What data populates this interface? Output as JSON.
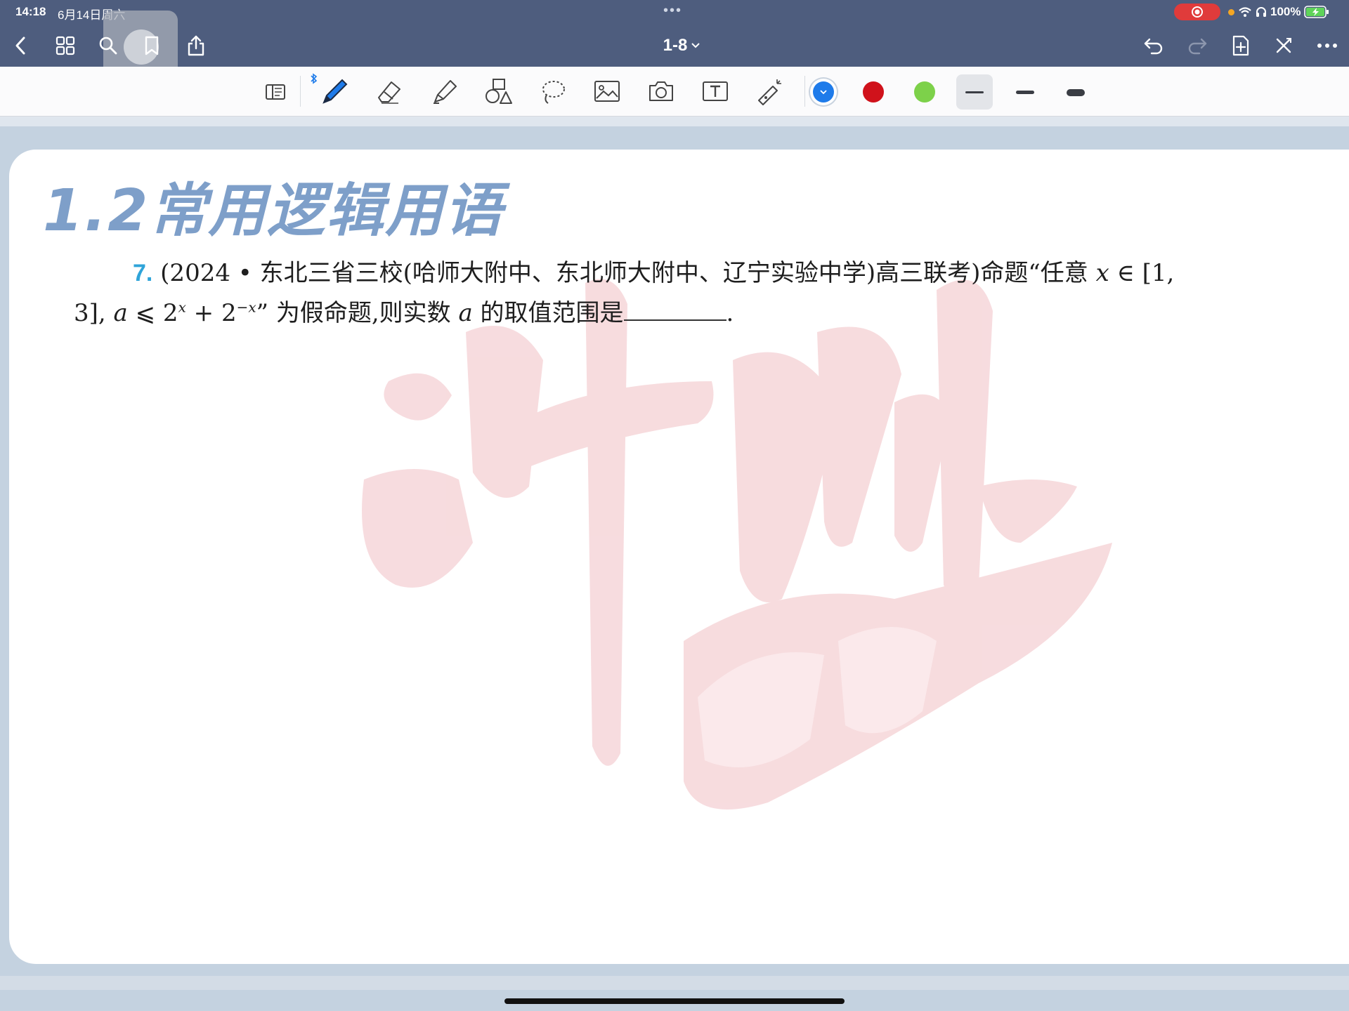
{
  "status_bar": {
    "time": "14:18",
    "date": "6月14日周六",
    "center_dots": "•••",
    "battery": "100%"
  },
  "nav": {
    "page_title": "1-8",
    "icons": [
      "back-icon",
      "grid-icon",
      "search-icon",
      "bookmark-icon",
      "share-icon",
      "undo-icon",
      "redo-icon",
      "add-page-icon",
      "close-icon",
      "more-icon"
    ]
  },
  "toolbar": {
    "tools": [
      "document-icon",
      "pen-icon",
      "eraser-icon",
      "highlighter-icon",
      "shapes-icon",
      "lasso-icon",
      "image-icon",
      "camera-icon",
      "text-icon",
      "laser-pointer-icon"
    ],
    "colors": {
      "selected_blue": "#1e7bea",
      "red": "#d0121b",
      "green": "#7dd14a"
    },
    "widths": [
      "thin",
      "medium",
      "thick"
    ]
  },
  "document": {
    "heading": "1.2常用逻辑用语",
    "problem": {
      "number": "7.",
      "line1_source": "(2024 • 东北三省三校(哈师大附中、东北师大附中、辽宁实验中学)高三联考)命题“任意",
      "line1_var": "x",
      "line1_tail": "∈ [1,",
      "line2_start": "3],",
      "line2_var_a": "a",
      "line2_leq": "⩽ 2",
      "line2_sup1": "x",
      "line2_plus": " + 2",
      "line2_sup2": "−x",
      "line2_mid": "” 为假命题,则实数",
      "line2_var_a2": "a",
      "line2_end": "的取值范围是",
      "line2_period": "."
    },
    "watermark_color": "#f6d6d9"
  }
}
